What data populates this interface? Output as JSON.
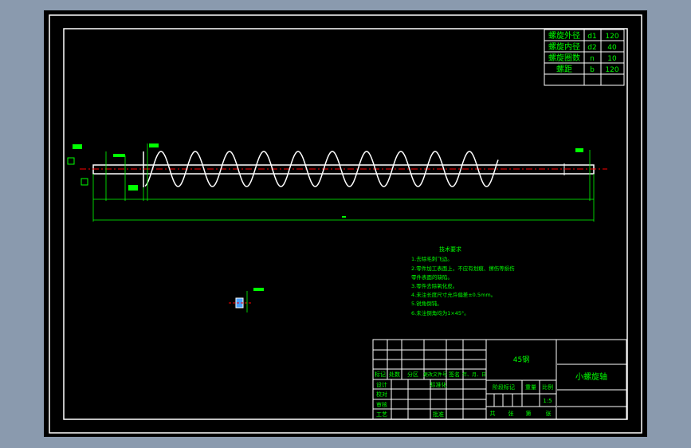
{
  "params_table": [
    {
      "name": "螺旋外径",
      "symbol": "d1",
      "value": "120"
    },
    {
      "name": "螺旋内径",
      "symbol": "d2",
      "value": "40"
    },
    {
      "name": "螺旋圈数",
      "symbol": "n",
      "value": "10"
    },
    {
      "name": "螺距",
      "symbol": "b",
      "value": "120"
    }
  ],
  "tech_req": {
    "title": "技术要求",
    "lines": [
      "1.去除毛刺飞边。",
      "2.零件加工表面上，不应有划痕、擦伤等损伤",
      "零件表面的缺陷。",
      "3.零件去除氧化皮。",
      "4.未注长度尺寸允许偏差±0.5mm。",
      "5.锐角倒钝。",
      "6.未注倒角均为1×45°。"
    ]
  },
  "title_block": {
    "header": [
      "标记",
      "处数",
      "分区",
      "更改文件号",
      "签名",
      "年、月、日"
    ],
    "roles": [
      "设计",
      "校对",
      "审核",
      "工艺"
    ],
    "standardize": "标准化",
    "approve": "批准",
    "material": "45钢",
    "stage_label": "阶段标记",
    "weight_label": "重量",
    "scale_label": "比例",
    "scale": "1:5",
    "sheets": [
      "共",
      "张",
      "第",
      "张"
    ],
    "part_name": "小螺旋轴"
  },
  "colors": {
    "background": "#8a9aae",
    "line": "#ffffff",
    "text": "#00ff00",
    "center": "#ff0000"
  }
}
